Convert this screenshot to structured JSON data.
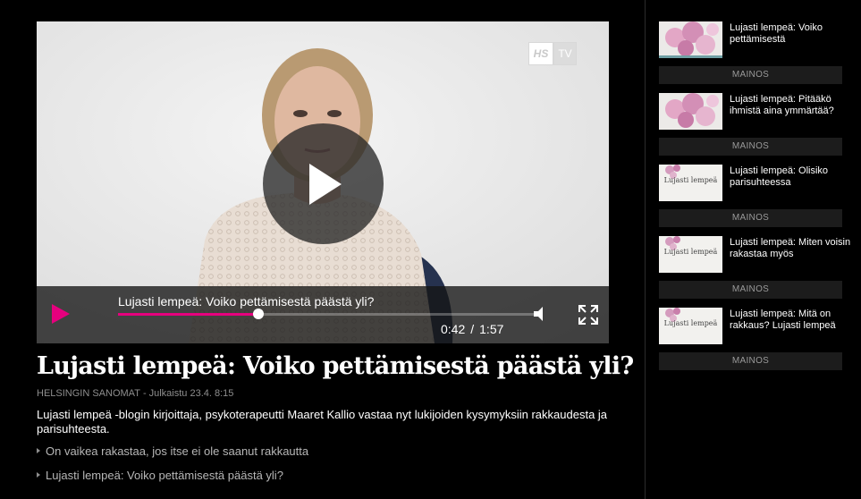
{
  "player": {
    "brand_hs": "HS",
    "brand_tv": "TV",
    "video_title": "Lujasti lempeä: Voiko pettämisestä päästä yli?",
    "current_time": "0:42",
    "duration": "1:57",
    "progress_fraction": 0.33,
    "accent_color": "#e6007e"
  },
  "article": {
    "title": "Lujasti lempeä: Voiko pettämisestä päästä yli?",
    "source": "HELSINGIN SANOMAT",
    "published": "Julkaistu 23.4. 8:15",
    "description": "Lujasti lempeä -blogin kirjoittaja, psykoterapeutti Maaret Kallio vastaa nyt lukijoiden kysymyksiin rakkaudesta ja parisuhteesta.",
    "links": [
      {
        "label": "On vaikea rakastaa, jos itse ei ole saanut rakkautta"
      },
      {
        "label": "Lujasti lempeä: Voiko pettämisestä päästä yli?"
      }
    ]
  },
  "sidebar": {
    "items": [
      {
        "label": "Lujasti lempeä: Voiko pettämisestä",
        "thumb_style": "orchid",
        "thumb_text": "",
        "active": true
      },
      {
        "label": "Lujasti lempeä: Pitääkö ihmistä aina ymmärtää?",
        "thumb_style": "orchid",
        "thumb_text": "",
        "active": false
      },
      {
        "label": "Lujasti lempeä: Olisiko parisuhteessa",
        "thumb_style": "card",
        "thumb_text": "Lujasti lempeä",
        "active": false
      },
      {
        "label": "Lujasti lempeä: Miten voisin rakastaa myös",
        "thumb_style": "card",
        "thumb_text": "Lujasti lempeä",
        "active": false
      },
      {
        "label": "Lujasti lempeä: Mitä on rakkaus? Lujasti lempeä",
        "thumb_style": "card",
        "thumb_text": "Lujasti lempeä",
        "active": false
      }
    ],
    "ad_label": "MAINOS"
  }
}
